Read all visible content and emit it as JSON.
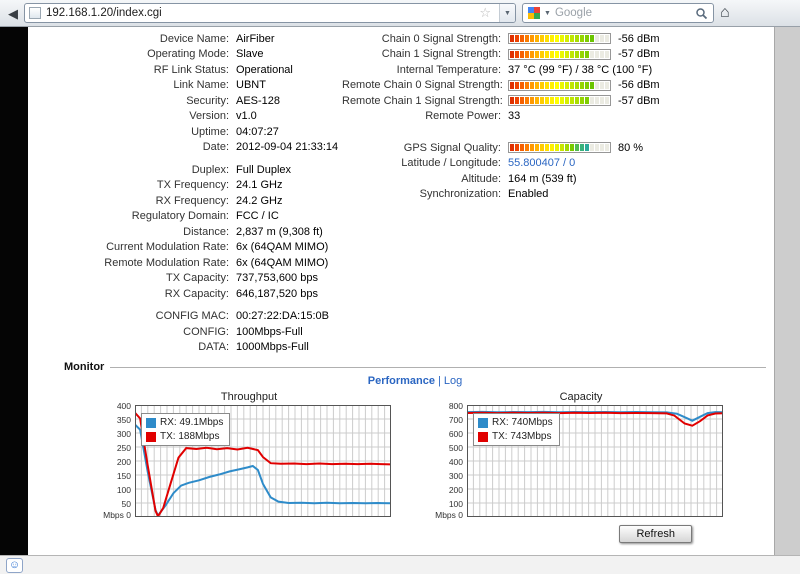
{
  "browser": {
    "url": "192.168.1.20/index.cgi",
    "search_placeholder": "Google"
  },
  "colors": {
    "link": "#2b66c2",
    "chart_rx": "#2e8bc9",
    "chart_tx": "#e10000"
  },
  "status_left": [
    [
      {
        "label": "Device Name:",
        "value": "AirFiber"
      },
      {
        "label": "Operating Mode:",
        "value": "Slave"
      },
      {
        "label": "RF Link Status:",
        "value": "Operational"
      },
      {
        "label": "Link Name:",
        "value": "UBNT"
      },
      {
        "label": "Security:",
        "value": "AES-128"
      },
      {
        "label": "Version:",
        "value": "v1.0"
      },
      {
        "label": "Uptime:",
        "value": "04:07:27"
      },
      {
        "label": "Date:",
        "value": "2012-09-04 21:33:14"
      }
    ],
    [
      {
        "label": "Duplex:",
        "value": "Full Duplex"
      },
      {
        "label": "TX Frequency:",
        "value": "24.1 GHz"
      },
      {
        "label": "RX Frequency:",
        "value": "24.2 GHz"
      },
      {
        "label": "Regulatory Domain:",
        "value": "FCC / IC"
      },
      {
        "label": "Distance:",
        "value": "2,837 m (9,308 ft)"
      },
      {
        "label": "Current Modulation Rate:",
        "value": "6x (64QAM MIMO)"
      },
      {
        "label": "Remote Modulation Rate:",
        "value": "6x (64QAM MIMO)"
      },
      {
        "label": "TX Capacity:",
        "value": "737,753,600 bps"
      },
      {
        "label": "RX Capacity:",
        "value": "646,187,520 bps"
      }
    ],
    [
      {
        "label": "CONFIG MAC:",
        "value": "00:27:22:DA:15:0B"
      },
      {
        "label": "CONFIG:",
        "value": "100Mbps-Full"
      },
      {
        "label": "DATA:",
        "value": "1000Mbps-Full"
      }
    ]
  ],
  "status_right": [
    [
      {
        "label": "Chain 0 Signal Strength:",
        "gauge": "signal",
        "lit": 17,
        "value": "-56 dBm"
      },
      {
        "label": "Chain 1 Signal Strength:",
        "gauge": "signal",
        "lit": 16,
        "value": "-57 dBm"
      },
      {
        "label": "Internal Temperature:",
        "value": "37 °C (99 °F) / 38 °C (100 °F)"
      },
      {
        "label": "Remote Chain 0 Signal Strength:",
        "gauge": "signal",
        "lit": 17,
        "value": "-56 dBm"
      },
      {
        "label": "Remote Chain 1 Signal Strength:",
        "gauge": "signal",
        "lit": 16,
        "value": "-57 dBm"
      },
      {
        "label": "Remote Power:",
        "value": "33"
      }
    ],
    [
      {
        "label": "GPS Signal Quality:",
        "gauge": "gps",
        "lit": 16,
        "value": "80 %"
      },
      {
        "label": "Latitude / Longitude:",
        "value": "55.800407 / 0",
        "link": true
      },
      {
        "label": "Altitude:",
        "value": "164 m (539 ft)"
      },
      {
        "label": "Synchronization:",
        "value": "Enabled"
      }
    ]
  ],
  "gauges": {
    "segments": 20,
    "off_color": "#ebebe2",
    "ramps": {
      "signal": [
        "#e03000",
        "#ee4400",
        "#f66000",
        "#fb7d00",
        "#ff9900",
        "#ffb300",
        "#ffcc00",
        "#ffe000",
        "#fff000",
        "#ffff00",
        "#eaf700",
        "#d5ee00",
        "#bfe600",
        "#aadd00",
        "#95d500",
        "#80cc00",
        "#6ac400",
        "#55bb00",
        "#40b300",
        "#2baa00"
      ],
      "gps": [
        "#e03000",
        "#ee4400",
        "#f66000",
        "#fb7d00",
        "#ff9900",
        "#ffb300",
        "#ffcc00",
        "#ffe000",
        "#fff000",
        "#e8f200",
        "#c8e600",
        "#a0d800",
        "#78ca00",
        "#50bc50",
        "#38b27c",
        "#2caa9a",
        "#24a2ac",
        "#1c9ab4",
        "#1691bc",
        "#1089c4"
      ]
    }
  },
  "monitor": {
    "title": "Monitor",
    "performance_link": "Performance",
    "separator": "|",
    "log_link": "Log",
    "refresh_button": "Refresh"
  },
  "chart_data": [
    {
      "type": "line",
      "title": "Throughput",
      "xlabel": "",
      "ylabel_zero": "Mbps 0",
      "ylim": [
        0,
        400
      ],
      "ytick_step": 50,
      "grid": true,
      "legend_position": "top-left",
      "series": [
        {
          "name": "RX: 49.1Mbps",
          "color": "#2e8bc9",
          "points": [
            [
              0,
              330
            ],
            [
              2,
              312
            ],
            [
              5,
              160
            ],
            [
              8,
              25
            ],
            [
              9,
              5
            ],
            [
              12,
              42
            ],
            [
              15,
              85
            ],
            [
              18,
              112
            ],
            [
              21,
              122
            ],
            [
              25,
              131
            ],
            [
              29,
              143
            ],
            [
              33,
              152
            ],
            [
              37,
              163
            ],
            [
              41,
              171
            ],
            [
              44,
              177
            ],
            [
              46,
              182
            ],
            [
              48,
              168
            ],
            [
              50,
              118
            ],
            [
              53,
              70
            ],
            [
              56,
              55
            ],
            [
              60,
              50
            ],
            [
              65,
              51
            ],
            [
              70,
              49
            ],
            [
              75,
              51
            ],
            [
              80,
              49
            ],
            [
              85,
              50
            ],
            [
              90,
              49
            ],
            [
              95,
              50
            ],
            [
              100,
              49
            ]
          ]
        },
        {
          "name": "TX: 188Mbps",
          "color": "#e10000",
          "points": [
            [
              0,
              372
            ],
            [
              2,
              352
            ],
            [
              5,
              182
            ],
            [
              8,
              22
            ],
            [
              9,
              2
            ],
            [
              11,
              32
            ],
            [
              14,
              122
            ],
            [
              17,
              212
            ],
            [
              20,
              246
            ],
            [
              24,
              243
            ],
            [
              28,
              247
            ],
            [
              32,
              242
            ],
            [
              36,
              246
            ],
            [
              40,
              241
            ],
            [
              44,
              247
            ],
            [
              48,
              239
            ],
            [
              50,
              214
            ],
            [
              53,
              192
            ],
            [
              57,
              190
            ],
            [
              62,
              191
            ],
            [
              67,
              189
            ],
            [
              72,
              191
            ],
            [
              77,
              189
            ],
            [
              82,
              190
            ],
            [
              87,
              189
            ],
            [
              92,
              190
            ],
            [
              96,
              189
            ],
            [
              100,
              188
            ]
          ]
        }
      ]
    },
    {
      "type": "line",
      "title": "Capacity",
      "xlabel": "",
      "ylabel_zero": "Mbps 0",
      "ylim": [
        0,
        800
      ],
      "ytick_step": 100,
      "grid": true,
      "legend_position": "top-left",
      "series": [
        {
          "name": "RX: 740Mbps",
          "color": "#2e8bc9",
          "points": [
            [
              0,
              749
            ],
            [
              6,
              751
            ],
            [
              12,
              748
            ],
            [
              18,
              750
            ],
            [
              24,
              749
            ],
            [
              30,
              751
            ],
            [
              36,
              748
            ],
            [
              42,
              750
            ],
            [
              48,
              749
            ],
            [
              54,
              750
            ],
            [
              60,
              748
            ],
            [
              66,
              750
            ],
            [
              72,
              748
            ],
            [
              78,
              747
            ],
            [
              82,
              738
            ],
            [
              86,
              705
            ],
            [
              88,
              688
            ],
            [
              91,
              716
            ],
            [
              94,
              742
            ],
            [
              97,
              749
            ],
            [
              100,
              748
            ]
          ]
        },
        {
          "name": "TX: 743Mbps",
          "color": "#e10000",
          "points": [
            [
              0,
              743
            ],
            [
              6,
              744
            ],
            [
              12,
              742
            ],
            [
              18,
              744
            ],
            [
              24,
              743
            ],
            [
              30,
              744
            ],
            [
              36,
              742
            ],
            [
              42,
              744
            ],
            [
              48,
              743
            ],
            [
              54,
              744
            ],
            [
              60,
              742
            ],
            [
              66,
              743
            ],
            [
              72,
              742
            ],
            [
              78,
              740
            ],
            [
              81,
              724
            ],
            [
              85,
              668
            ],
            [
              88,
              652
            ],
            [
              91,
              684
            ],
            [
              94,
              726
            ],
            [
              97,
              739
            ],
            [
              100,
              741
            ]
          ]
        }
      ]
    }
  ]
}
